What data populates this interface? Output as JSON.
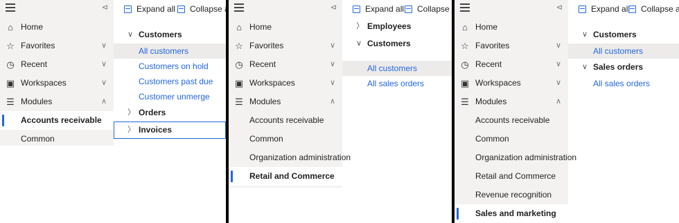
{
  "icons": {
    "hamburger": "hamburger-icon",
    "pin": "pin-icon",
    "home": "home-icon",
    "favorites": "star-icon",
    "recent": "clock-icon",
    "workspaces": "workspace-icon",
    "modules": "list-icon",
    "expand_all": "expand-all-icon",
    "collapse_all": "collapse-all-icon"
  },
  "glyphs": {
    "pin": "⊲",
    "home": "⌂",
    "star": "☆",
    "clock": "◷",
    "workspace": "▣",
    "modules": "☰",
    "chev_down": "∨",
    "chev_up": "∧",
    "chev_right": "〉",
    "tree_down": "∨"
  },
  "colors": {
    "accent": "#2266e3",
    "nav_bg": "#f3f2f1",
    "selected_bg": "#edebe9"
  },
  "nav": {
    "home": "Home",
    "favorites": "Favorites",
    "recent": "Recent",
    "workspaces": "Workspaces",
    "modules": "Modules"
  },
  "toolbar": {
    "expand_all": "Expand all",
    "collapse_all": "Collapse all"
  },
  "panel1": {
    "modules": [
      "Accounts receivable",
      "Common"
    ],
    "active_module": "Accounts receivable",
    "tree": {
      "customers": "Customers",
      "customer_links": [
        "All customers",
        "Customers on hold",
        "Customers past due",
        "Customer unmerge"
      ],
      "orders": "Orders",
      "invoices": "Invoices"
    }
  },
  "panel2": {
    "modules": [
      "Accounts receivable",
      "Common",
      "Organization administration",
      "Retail and Commerce"
    ],
    "active_module": "Retail and Commerce",
    "tree": {
      "employees": "Employees",
      "customers": "Customers",
      "customer_links": [
        "All customers",
        "All sales orders"
      ]
    }
  },
  "panel3": {
    "modules": [
      "Accounts receivable",
      "Common",
      "Organization administration",
      "Retail and Commerce",
      "Revenue recognition",
      "Sales and marketing"
    ],
    "active_module": "Sales and marketing",
    "tree": {
      "customers": "Customers",
      "customer_links": [
        "All customers"
      ],
      "sales_orders": "Sales orders",
      "sales_links": [
        "All sales orders"
      ]
    }
  }
}
